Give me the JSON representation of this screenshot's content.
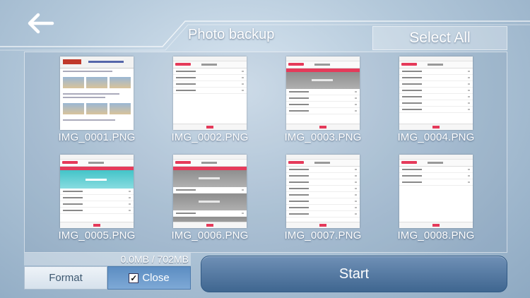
{
  "header": {
    "back_icon": "back-arrow-icon",
    "title": "Photo backup",
    "select_all_label": "Select All"
  },
  "gallery": {
    "photos": [
      {
        "filename": "IMG_0001.PNG"
      },
      {
        "filename": "IMG_0002.PNG"
      },
      {
        "filename": "IMG_0003.PNG"
      },
      {
        "filename": "IMG_0004.PNG"
      },
      {
        "filename": "IMG_0005.PNG"
      },
      {
        "filename": "IMG_0006.PNG"
      },
      {
        "filename": "IMG_0007.PNG"
      },
      {
        "filename": "IMG_0008.PNG"
      }
    ]
  },
  "footer": {
    "storage_text": "0.0MB / 702MB",
    "format_label": "Format",
    "close_label": "Close",
    "close_checked": true,
    "start_label": "Start"
  },
  "colors": {
    "accent_red": "#e53a5a",
    "start_button": "#4f77a0",
    "close_button": "#6b9acb"
  }
}
